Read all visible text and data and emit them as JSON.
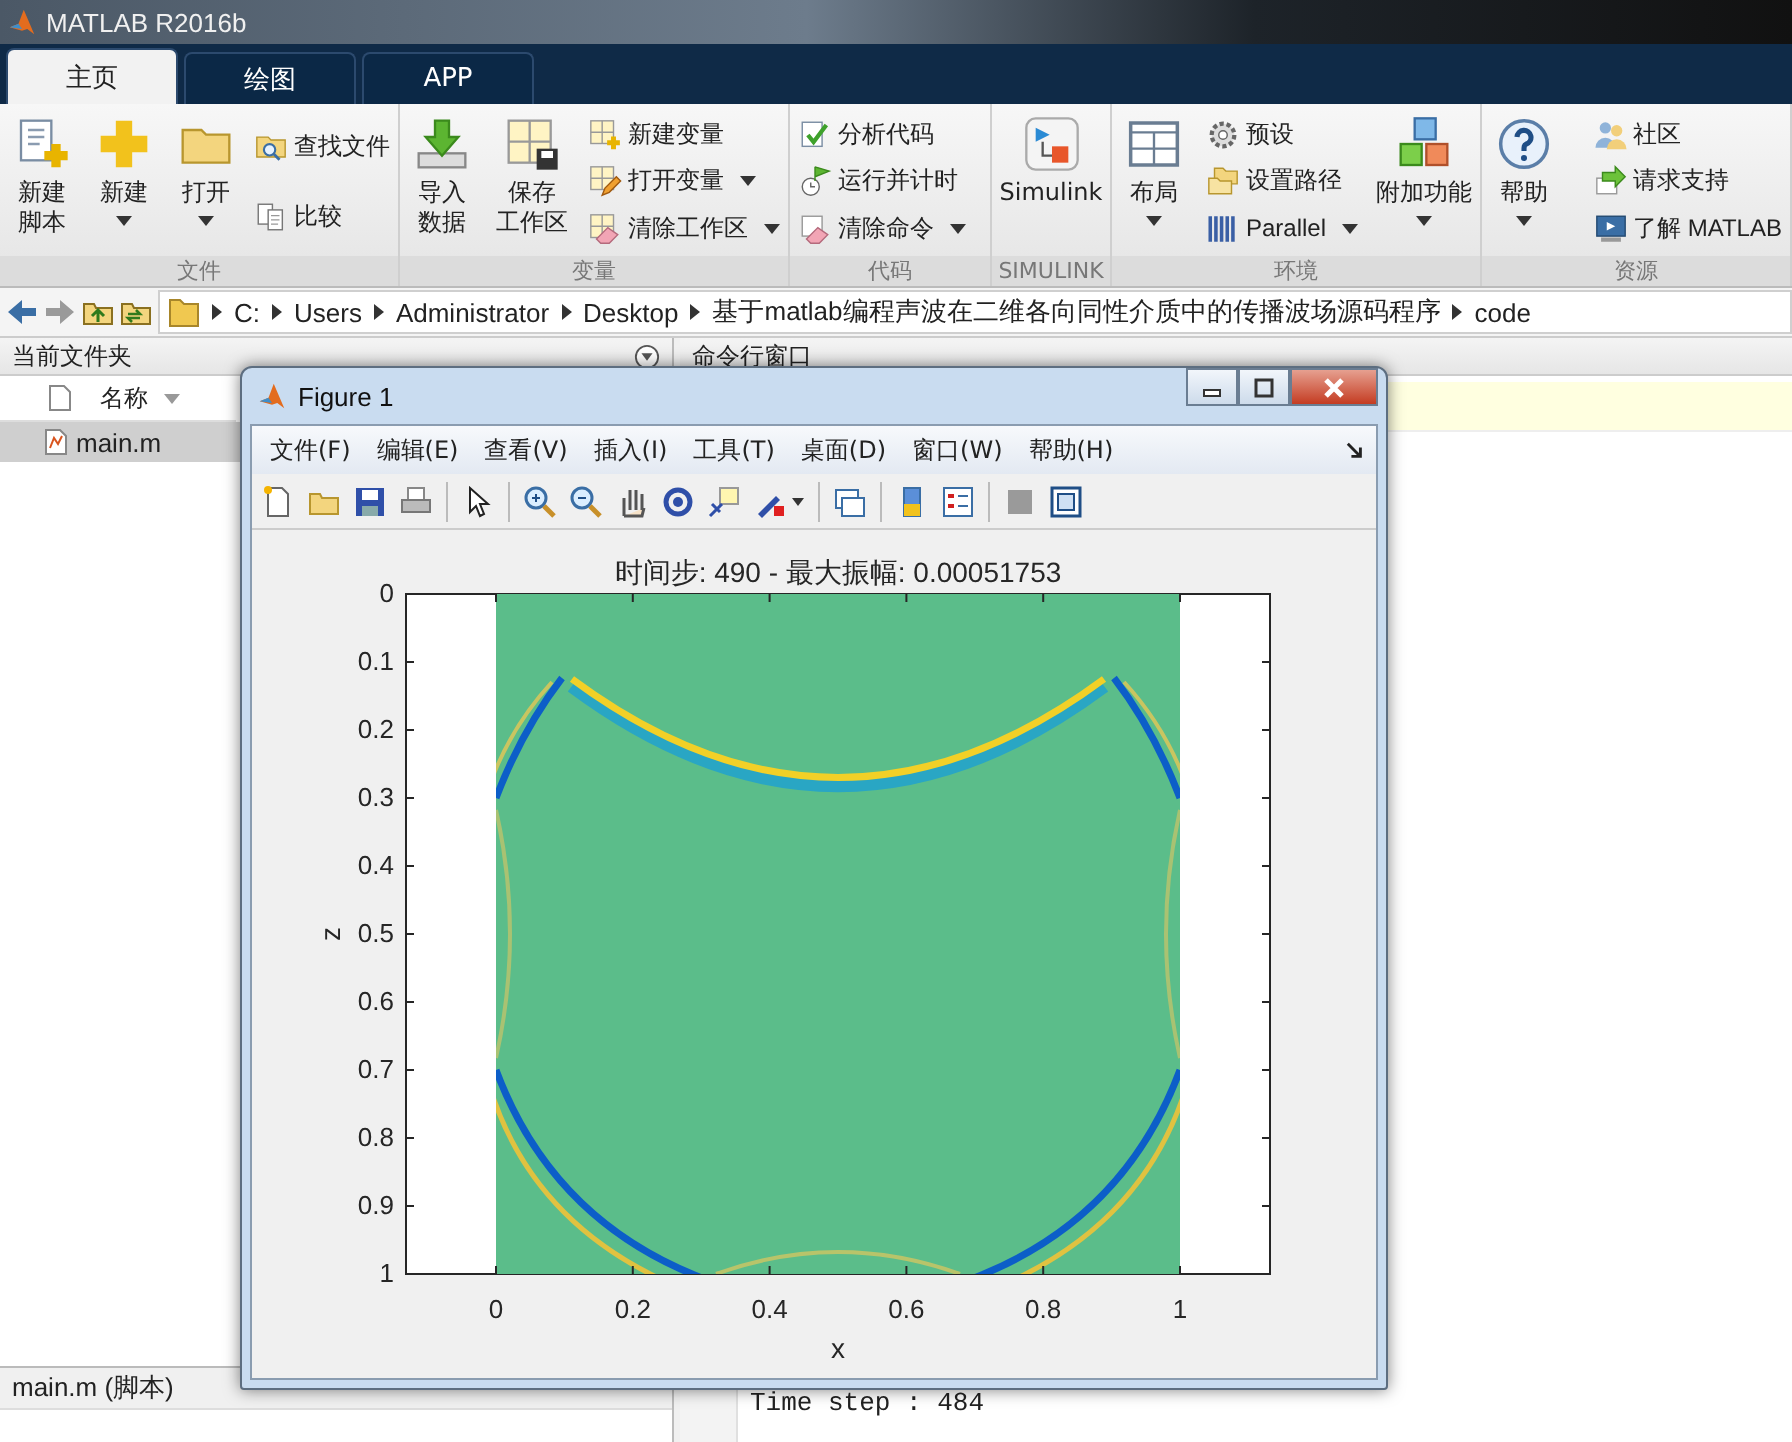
{
  "window": {
    "title": "MATLAB R2016b"
  },
  "tabs": [
    {
      "label": "主页",
      "selected": true
    },
    {
      "label": "绘图",
      "selected": false
    },
    {
      "label": "APP",
      "selected": false
    }
  ],
  "toolstrip": [
    {
      "label": "文件",
      "columns": [
        {
          "kind": "large",
          "lines": [
            "新建",
            "脚本"
          ],
          "dropdown": false
        },
        {
          "kind": "large",
          "lines": [
            "新建"
          ],
          "dropdown": true
        },
        {
          "kind": "large",
          "lines": [
            "打开"
          ],
          "dropdown": true
        },
        {
          "kind": "stack",
          "items": [
            {
              "label": "查找文件",
              "dropdown": false
            },
            {
              "label": "比较",
              "dropdown": false
            }
          ]
        }
      ]
    },
    {
      "label": "变量",
      "columns": [
        {
          "kind": "large",
          "lines": [
            "导入",
            "数据"
          ],
          "dropdown": false
        },
        {
          "kind": "large",
          "lines": [
            "保存",
            "工作区"
          ],
          "dropdown": false
        },
        {
          "kind": "stack",
          "items": [
            {
              "label": "新建变量",
              "dropdown": false
            },
            {
              "label": "打开变量",
              "dropdown": true
            },
            {
              "label": "清除工作区",
              "dropdown": true
            }
          ]
        }
      ]
    },
    {
      "label": "代码",
      "columns": [
        {
          "kind": "stack",
          "items": [
            {
              "label": "分析代码",
              "dropdown": false
            },
            {
              "label": "运行并计时",
              "dropdown": false
            },
            {
              "label": "清除命令",
              "dropdown": true
            }
          ]
        }
      ]
    },
    {
      "label": "SIMULINK",
      "columns": [
        {
          "kind": "large",
          "lines": [
            "Simulink"
          ],
          "dropdown": false
        }
      ]
    },
    {
      "label": "环境",
      "columns": [
        {
          "kind": "large",
          "lines": [
            "布局"
          ],
          "dropdown": true
        },
        {
          "kind": "stack",
          "items": [
            {
              "label": "预设",
              "dropdown": false
            },
            {
              "label": "设置路径",
              "dropdown": false
            },
            {
              "label": "Parallel",
              "dropdown": true
            }
          ]
        },
        {
          "kind": "large",
          "lines": [
            "附加功能"
          ],
          "dropdown": true
        }
      ]
    },
    {
      "label": "资源",
      "columns": [
        {
          "kind": "large",
          "lines": [
            "帮助"
          ],
          "dropdown": true
        },
        {
          "kind": "stack",
          "items": [
            {
              "label": "社区",
              "dropdown": false
            },
            {
              "label": "请求支持",
              "dropdown": false
            },
            {
              "label": "了解 MATLAB",
              "dropdown": false
            }
          ]
        }
      ]
    }
  ],
  "address_bar": {
    "segments": [
      "C:",
      "Users",
      "Administrator",
      "Desktop",
      "基于matlab编程声波在二维各向同性介质中的传播波场源码程序",
      "code"
    ]
  },
  "current_folder": {
    "title": "当前文件夹",
    "column": "名称",
    "files": [
      {
        "name": "main.m",
        "selected": true
      }
    ],
    "details_title": "main.m (脚本)"
  },
  "command_window": {
    "title": "命令行窗口",
    "lines": [
      "Time step : 484"
    ]
  },
  "figure": {
    "title": "Figure 1",
    "menus": [
      "文件(F)",
      "编辑(E)",
      "查看(V)",
      "插入(I)",
      "工具(T)",
      "桌面(D)",
      "窗口(W)",
      "帮助(H)"
    ],
    "plot": {
      "title": "时间步: 490 - 最大振幅: 0.00051753",
      "xlabel": "x",
      "ylabel": "z",
      "xticks": [
        "0",
        "0.2",
        "0.4",
        "0.6",
        "0.8",
        "1"
      ],
      "yticks": [
        "0",
        "0.1",
        "0.2",
        "0.3",
        "0.4",
        "0.5",
        "0.6",
        "0.7",
        "0.8",
        "0.9",
        "1"
      ]
    }
  }
}
